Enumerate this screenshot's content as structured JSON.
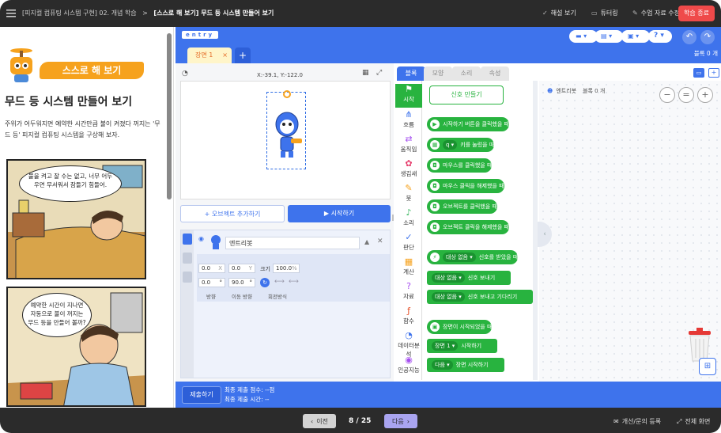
{
  "topbar": {
    "breadcrumb_course": "[피지컬 컴퓨팅 시스템 구현] 02. 개념 학습",
    "breadcrumb_separator": ">",
    "breadcrumb_page": "[스스로 해 보기] 무드 등 시스템 만들어 보기",
    "actions": [
      "해설 보기",
      "튜터링",
      "수업 자료 수정"
    ],
    "finish_label": "학습 종료"
  },
  "lesson": {
    "badge": "스스로 해 보기",
    "title": "무드 등 시스템 만들어 보기",
    "description": "주위가 어두워지면 예약한 시간만큼 불이 켜졌다 꺼지는 '무드 등' 피지컬 컴퓨팅 시스템을 구상해 보자.",
    "comic1_bubble": "불을 켜고 잘 수는 없고, 너무 어두우면 무서워서 잠들기 힘들어.",
    "comic2_bubble": "예약한 시간이 지나면 자동으로 불이 꺼지는 무드 등을 만들어 볼까?"
  },
  "entry": {
    "logo": "entry",
    "scene_tab": "장면 1",
    "scene_close": "×",
    "scene_add": "+",
    "block_count": "블록 0 개",
    "stage": {
      "coords": "X:-39.1, Y:-122.0"
    },
    "add_object_label": "+ 오브젝트 추가하기",
    "start_label": "▶ 시작하기",
    "object": {
      "name": "엔트리봇",
      "x_value": "0.0",
      "x_label": "X",
      "y_value": "0.0",
      "y_label": "Y",
      "size_label": "크기",
      "size_value": "100.0",
      "size_unit": "%",
      "direction_value": "0.0",
      "direction_unit": "°",
      "move_direction_value": "90.0",
      "move_direction_unit": "°",
      "direction_label": "방향",
      "move_direction_label": "이동 방향",
      "rotation_label": "회전방식"
    },
    "palette_tabs": [
      "블록",
      "모양",
      "소리",
      "속성"
    ],
    "categories": [
      "시작",
      "흐름",
      "움직임",
      "생김새",
      "붓",
      "소리",
      "판단",
      "계산",
      "자료",
      "함수",
      "데이터분석",
      "인공지능"
    ],
    "make_signal_label": "신호 만들기",
    "blocks": [
      {
        "text": "시작하기 버튼을 클릭했을 때",
        "dropdown": ""
      },
      {
        "text": "키를 눌렀을 때",
        "dropdown": "q ▾"
      },
      {
        "text": "마우스를 클릭했을 때",
        "dropdown": ""
      },
      {
        "text": "마우스 클릭을 해제했을 때",
        "dropdown": ""
      },
      {
        "text": "오브젝트를 클릭했을 때",
        "dropdown": ""
      },
      {
        "text": "오브젝트 클릭을 해제했을 때",
        "dropdown": ""
      },
      {
        "text": "신호를 받았을 때",
        "dropdown": "대상 없음 ▾"
      },
      {
        "text": "신호 보내기",
        "dropdown": "대상 없음 ▾"
      },
      {
        "text": "신호 보내고 기다리기",
        "dropdown": "대상 없음 ▾"
      },
      {
        "text": "장면이 시작되었을 때",
        "dropdown": ""
      },
      {
        "text": "시작하기",
        "dropdown": "장면 1 ▾"
      },
      {
        "text": "장면 시작하기",
        "dropdown": "다음 ▾"
      }
    ],
    "workspace": {
      "object_label": "엔트리봇",
      "block_count": "블록 0 개"
    }
  },
  "submit": {
    "button_label": "제출하기",
    "final_score": "최종 제출 점수: --점",
    "final_time": "최종 제출 시간: --"
  },
  "footer": {
    "prev_label": "이전",
    "page_indicator": "8 / 25",
    "next_label": "다음",
    "feedback_label": "개선/문의 등록",
    "fullscreen_label": "전체 화면"
  },
  "colors": {
    "entry_blue": "#3e73ec",
    "start_green": "#28b33f",
    "finish_red": "#ef4a4a",
    "badge_orange": "#f6a21d"
  }
}
